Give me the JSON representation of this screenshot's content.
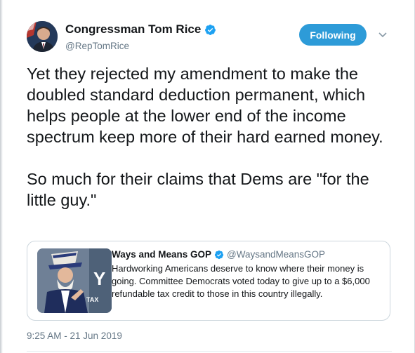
{
  "tweet": {
    "author": {
      "display_name": "Congressman Tom Rice",
      "handle": "@RepTomRice",
      "verified": true
    },
    "follow_button_label": "Following",
    "text": "Yet they rejected my amendment to make the doubled standard deduction permanent, which helps people at the lower end of the income spectrum keep more of their hard earned money.\n\nSo much for their claims that Dems are \"for the little guy.\"",
    "timestamp": "9:25 AM - 21 Jun 2019"
  },
  "quoted_tweet": {
    "display_name": "Ways and Means GOP",
    "handle": "@WaysandMeansGOP",
    "verified": true,
    "text": "Hardworking Americans deserve to know where their money is going. Committee Democrats voted today to give up to a $6,000 refundable tax credit to those in this country illegally.",
    "image_overlay_text": "TAX"
  },
  "colors": {
    "accent": "#2d9bd8",
    "secondary_text": "#657786",
    "verified_badge": "#1da1f2"
  },
  "icons": {
    "verified": "verified-badge-icon",
    "menu": "chevron-down-icon"
  }
}
